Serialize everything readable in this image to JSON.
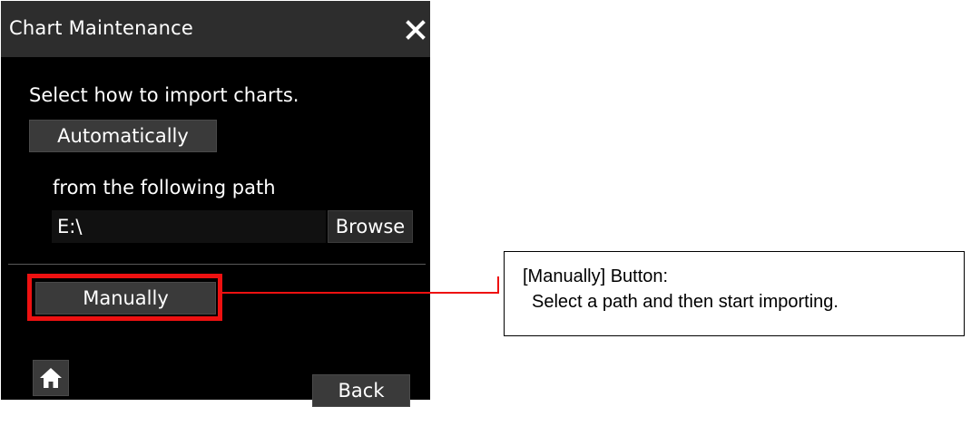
{
  "dialog": {
    "title": "Chart Maintenance",
    "close_icon": "close-icon",
    "prompt": "Select how to import charts.",
    "automatically_label": "Automatically",
    "path_label": "from the following path",
    "path_value": "E:\\",
    "browse_label": "Browse",
    "manually_label": "Manually",
    "home_icon": "home-icon",
    "back_label": "Back"
  },
  "callout": {
    "title": "[Manually] Button:",
    "description": "Select a path and then start importing."
  },
  "colors": {
    "panel_background": "#000000",
    "title_bar": "#2d2d2d",
    "button": "#3a3a3a",
    "highlight": "#ee1111"
  }
}
